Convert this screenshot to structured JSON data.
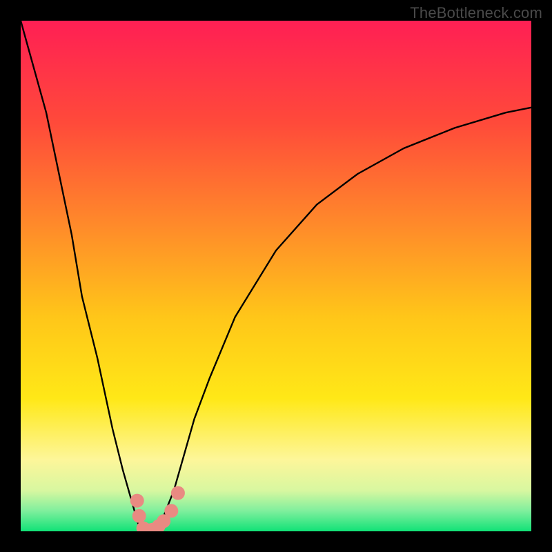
{
  "watermark": "TheBottleneck.com",
  "chart_data": {
    "type": "line",
    "title": "",
    "xlabel": "",
    "ylabel": "",
    "xlim": [
      0,
      100
    ],
    "ylim": [
      0,
      100
    ],
    "series": [
      {
        "name": "bottleneck-curve",
        "x": [
          0,
          5,
          10,
          12,
          15,
          18,
          20,
          22,
          23,
          24,
          25,
          26,
          27,
          28,
          30,
          32,
          34,
          37,
          42,
          50,
          58,
          66,
          75,
          85,
          95,
          100
        ],
        "y": [
          100,
          82,
          58,
          46,
          34,
          20,
          12,
          5,
          1.5,
          0.3,
          0,
          0.3,
          1.2,
          3,
          8,
          15,
          22,
          30,
          42,
          55,
          64,
          70,
          75,
          79,
          82,
          83
        ]
      }
    ],
    "markers": [
      {
        "name": "sample-points",
        "x": [
          22.8,
          23.2,
          24.0,
          25.0,
          25.8,
          27.0,
          28.0,
          29.5,
          30.8
        ],
        "y": [
          6.0,
          3.0,
          0.6,
          0.2,
          0.3,
          1.0,
          2.0,
          4.0,
          7.5
        ]
      }
    ],
    "gradient": {
      "stops": [
        {
          "pos": 0.0,
          "color": "#ff1f54"
        },
        {
          "pos": 0.2,
          "color": "#ff4a3a"
        },
        {
          "pos": 0.4,
          "color": "#ff8a2a"
        },
        {
          "pos": 0.58,
          "color": "#ffc619"
        },
        {
          "pos": 0.74,
          "color": "#ffe817"
        },
        {
          "pos": 0.86,
          "color": "#fdf69a"
        },
        {
          "pos": 0.92,
          "color": "#d8f7a0"
        },
        {
          "pos": 0.96,
          "color": "#7fef9d"
        },
        {
          "pos": 1.0,
          "color": "#11e277"
        }
      ]
    }
  }
}
